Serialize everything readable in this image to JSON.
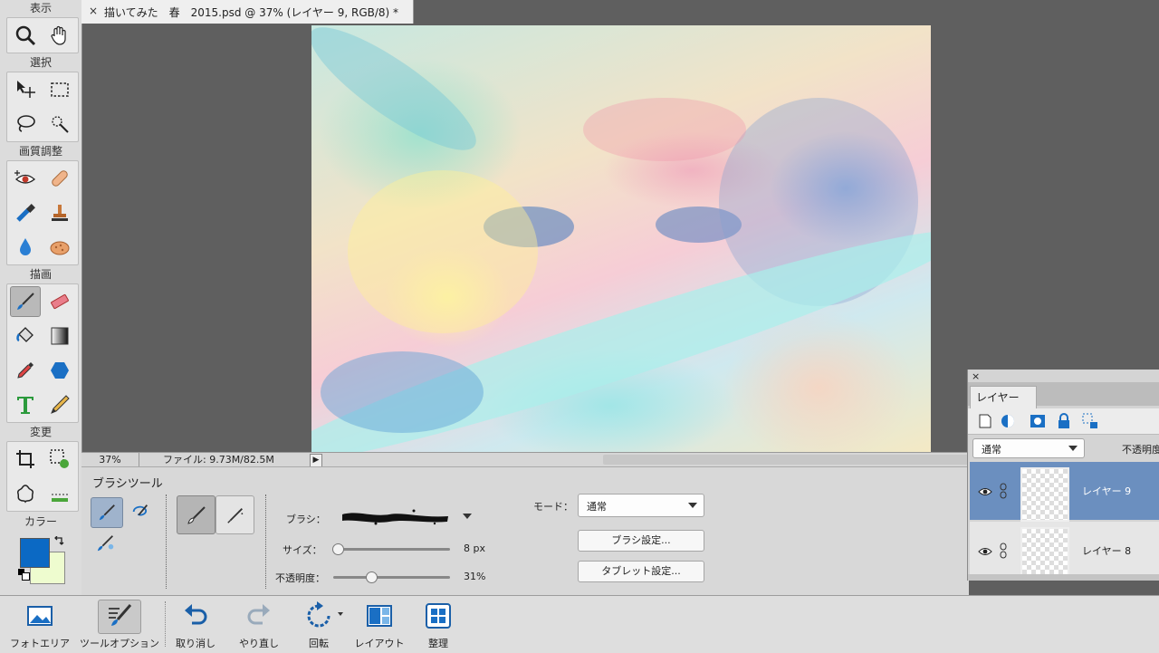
{
  "document": {
    "tab_title": "描いてみた　春　2015.psd @ 37% (レイヤー 9, RGB/8) *",
    "close_glyph": "×"
  },
  "toolbox": {
    "sections": {
      "view": "表示",
      "select": "選択",
      "enhance": "画質調整",
      "draw": "描画",
      "modify": "変更",
      "color": "カラー"
    },
    "active_tool": "brush-tool"
  },
  "colors": {
    "foreground": "#0b69c4",
    "background": "#eefccf",
    "selection": "#6b8fbf"
  },
  "status": {
    "zoom": "37%",
    "file_info": "ファイル: 9.73M/82.5M",
    "arrow": "▶"
  },
  "tool_options": {
    "tool_name": "ブラシツール",
    "brush_label": "ブラシ：",
    "size_label": "サイズ：",
    "size_value": "8 px",
    "size_level": 0.0,
    "opacity_label": "不透明度：",
    "opacity_value": "31%",
    "opacity_level": 0.31,
    "mode_label": "モード：",
    "mode_value": "通常",
    "brush_settings_button": "ブラシ設定...",
    "tablet_settings_button": "タブレット設定..."
  },
  "layers_panel": {
    "close": "×",
    "tab_label": "レイヤー",
    "blend_mode": "通常",
    "opacity_label": "不透明度",
    "layers": [
      {
        "name": "レイヤー 9",
        "selected": true
      },
      {
        "name": "レイヤー 8",
        "selected": false
      }
    ]
  },
  "bottom_bar": {
    "items": [
      {
        "label": "フォトエリア",
        "icon": "photo-bin-icon"
      },
      {
        "label": "ツールオプション",
        "icon": "tool-options-icon"
      },
      {
        "label": "取り消し",
        "icon": "undo-icon"
      },
      {
        "label": "やり直し",
        "icon": "redo-icon"
      },
      {
        "label": "回転",
        "icon": "rotate-icon"
      },
      {
        "label": "レイアウト",
        "icon": "layout-icon"
      },
      {
        "label": "整理",
        "icon": "organizer-icon"
      }
    ]
  }
}
